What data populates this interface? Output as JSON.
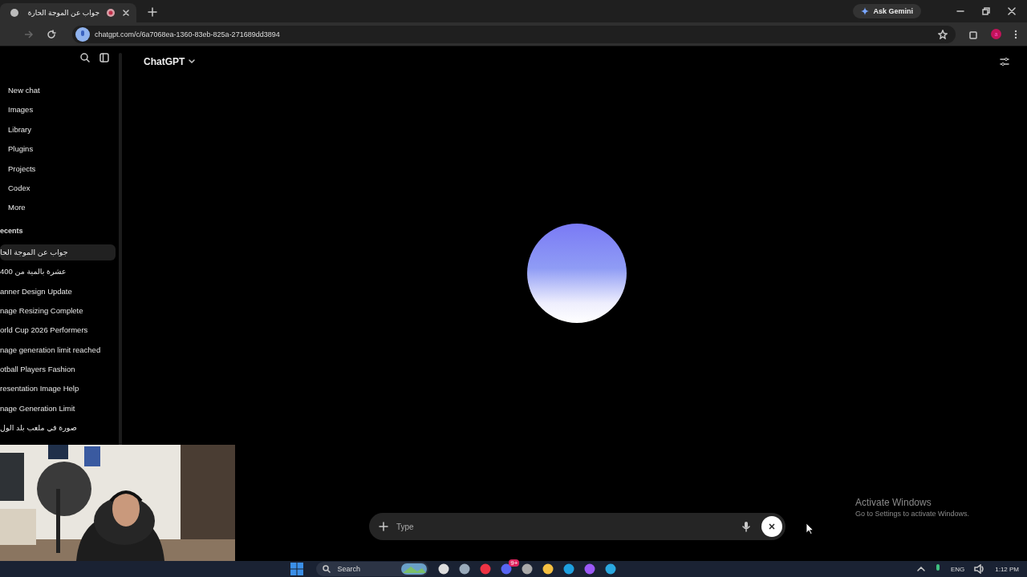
{
  "browser": {
    "tabs": [
      {
        "title": "جواب عن الموجة الحارة",
        "selected": true,
        "recording": true
      }
    ],
    "url": "chatgpt.com/c/6a7068ea-1360-83eb-825a-271689dd3894",
    "ask_button": "Ask Gemini",
    "profile_initial": "a"
  },
  "sidebar": {
    "nav": [
      {
        "label": "New chat"
      },
      {
        "label": "Images"
      },
      {
        "label": "Library"
      },
      {
        "label": "Plugins"
      },
      {
        "label": "Projects"
      },
      {
        "label": "Codex"
      },
      {
        "label": "More"
      }
    ],
    "recents_label": "ecents",
    "recents": [
      {
        "title": "جواب عن الموجة الحا",
        "selected": true
      },
      {
        "title": "عشرة بالمية من 400",
        "selected": false
      },
      {
        "title": "anner Design Update",
        "selected": false
      },
      {
        "title": "nage Resizing Complete",
        "selected": false
      },
      {
        "title": "orld Cup 2026 Performers",
        "selected": false
      },
      {
        "title": "nage generation limit reached",
        "selected": false
      },
      {
        "title": "otball Players Fashion",
        "selected": false
      },
      {
        "title": "resentation Image Help",
        "selected": false
      },
      {
        "title": "nage Generation Limit",
        "selected": false
      },
      {
        "title": "صورة في ملعب بلد الول",
        "selected": false
      }
    ]
  },
  "header": {
    "title": "ChatGPT"
  },
  "composer": {
    "placeholder": "Type"
  },
  "activation": {
    "title": "Activate Windows",
    "text": "Go to Settings to activate Windows."
  },
  "taskbar": {
    "search": "Search",
    "chat_badge": "9+",
    "language": "ENG",
    "time": "1:12 PM"
  }
}
